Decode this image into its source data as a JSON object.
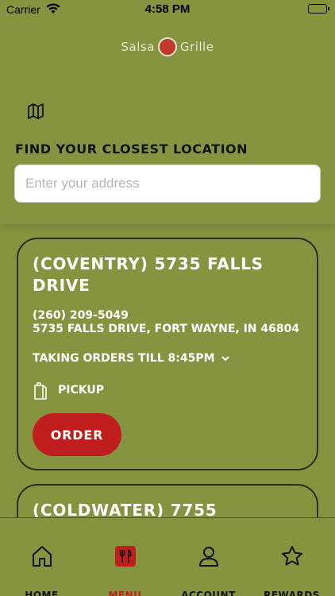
{
  "status_bar": {
    "carrier": "Carrier",
    "time": "4:58 PM"
  },
  "header": {
    "logo_left": "Salsa",
    "logo_right": "Grille",
    "map_icon": "map-icon"
  },
  "search": {
    "title": "FIND YOUR CLOSEST LOCATION",
    "placeholder": "Enter your address",
    "value": ""
  },
  "locations": [
    {
      "name": "(COVENTRY) 5735 FALLS DRIVE",
      "phone": "(260) 209-5049",
      "address": "5735 FALLS DRIVE, FORT WAYNE, IN 46804",
      "hours": "TAKING ORDERS TILL 8:45PM",
      "service": "PICKUP",
      "order_label": "ORDER"
    },
    {
      "name": "(COLDWATER) 7755"
    }
  ],
  "tabs": [
    {
      "label": "HOME",
      "icon": "home-icon",
      "active": false
    },
    {
      "label": "MENU",
      "icon": "menu-icon",
      "active": true
    },
    {
      "label": "ACCOUNT",
      "icon": "account-icon",
      "active": false
    },
    {
      "label": "REWARDS",
      "icon": "star-icon",
      "active": false
    }
  ],
  "colors": {
    "background": "#86933f",
    "accent": "#c01e1e",
    "text_dark": "#111111",
    "text_light": "#ffffff"
  }
}
